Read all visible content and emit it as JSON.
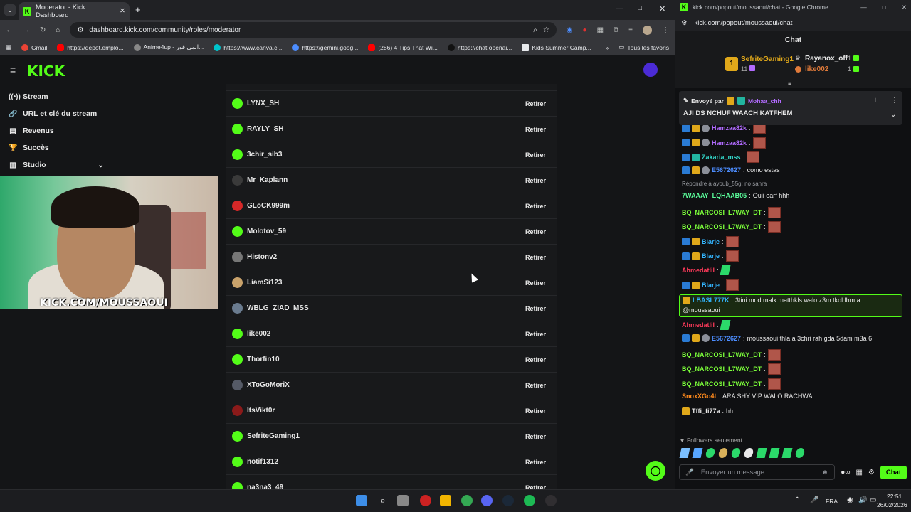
{
  "left_window": {
    "tab_title": "Moderator - Kick Dashboard",
    "url": "dashboard.kick.com/community/roles/moderator",
    "bookmarks": [
      "Gmail",
      "https://depot.emplo...",
      "Anime4up - انمي فور...",
      "https://www.canva.c...",
      "https://gemini.goog...",
      "(286) 4 Tips That Wi...",
      "https://chat.openai...",
      "Kids Summer Camp...",
      "Tous les favoris"
    ]
  },
  "brand": "KICK",
  "sidebar": {
    "items": [
      {
        "icon": "stream-icon",
        "label": "Stream"
      },
      {
        "icon": "link-icon",
        "label": "URL et clé du stream"
      },
      {
        "icon": "revenue-icon",
        "label": "Revenus"
      },
      {
        "icon": "trophy-icon",
        "label": "Succès"
      },
      {
        "icon": "studio-icon",
        "label": "Studio"
      }
    ]
  },
  "webcam_overlay": "KICK.COM/MOUSSAOUI",
  "moderators": {
    "remove_label": "Retirer",
    "rows": [
      {
        "name": "LYNX_SH",
        "avatar_color": "#53fc18"
      },
      {
        "name": "RAYLY_SH",
        "avatar_color": "#53fc18"
      },
      {
        "name": "3chir_sib3",
        "avatar_color": "#53fc18"
      },
      {
        "name": "Mr_Kaplann",
        "avatar_color": "#3a3a3a"
      },
      {
        "name": "GLoCK999m",
        "avatar_color": "#d62828"
      },
      {
        "name": "Molotov_59",
        "avatar_color": "#53fc18"
      },
      {
        "name": "Histonv2",
        "avatar_color": "#777777"
      },
      {
        "name": "LiamSi123",
        "avatar_color": "#c9a26b"
      },
      {
        "name": "WBLG_ZIAD_MSS",
        "avatar_color": "#6a7b8f"
      },
      {
        "name": "like002",
        "avatar_color": "#53fc18"
      },
      {
        "name": "Thorfin10",
        "avatar_color": "#53fc18"
      },
      {
        "name": "XToGoMoriX",
        "avatar_color": "#555a66"
      },
      {
        "name": "ItsVikt0r",
        "avatar_color": "#8b1a1a"
      },
      {
        "name": "SefriteGaming1",
        "avatar_color": "#53fc18"
      },
      {
        "name": "notif1312",
        "avatar_color": "#53fc18"
      },
      {
        "name": "na3na3_49",
        "avatar_color": "#53fc18"
      }
    ]
  },
  "chat": {
    "window_title": "kick.com/popout/moussaoui/chat - Google Chrome",
    "url": "kick.com/popout/moussaoui/chat",
    "header": "Chat",
    "leaders": [
      {
        "rank": "1",
        "name": "SefriteGaming1",
        "count": "11"
      },
      {
        "name": "Rayanox_off",
        "count": "1"
      },
      {
        "name": "like002",
        "count": "1"
      }
    ],
    "pinned": {
      "sent_by": "Envoyé par",
      "author": "Mohaa_chh",
      "message": "AJI DS NCHUF WAACH KATFHEM"
    },
    "messages": [
      {
        "user": "Hamzaa82k",
        "color": "#b26bff",
        "text": "",
        "emote": true
      },
      {
        "user": "Hamzaa82k",
        "color": "#b26bff",
        "text": "",
        "emote": true
      },
      {
        "user": "Zakaria_mss",
        "color": "#33d6c9",
        "text": "",
        "emote": true
      },
      {
        "user": "E5672627",
        "color": "#4c8dff",
        "text": "como estas",
        "emote": false
      },
      {
        "reply": "Répondre à ayoub_55g: no sahra"
      },
      {
        "user": "7WAAAY_LQHAAB05",
        "color": "#5bff9c",
        "text": "Ouii earf hhh",
        "emote": false
      },
      {
        "user": "BQ_NARCOSI_L7WAY_DT",
        "color": "#7cff3a",
        "text": "",
        "emote": true
      },
      {
        "user": "BQ_NARCOSI_L7WAY_DT",
        "color": "#7cff3a",
        "text": "",
        "emote": true
      },
      {
        "user": "Blarje",
        "color": "#33b5ff",
        "text": "",
        "emote": true
      },
      {
        "user": "Blarje",
        "color": "#33b5ff",
        "text": "",
        "emote": true
      },
      {
        "user": "Ahmedatlil",
        "color": "#ff3a5a",
        "text": "",
        "emote": false,
        "gem": true
      },
      {
        "user": "Blarje",
        "color": "#33b5ff",
        "text": "",
        "emote": true
      },
      {
        "user": "LBASL777K",
        "color": "#33b5ff",
        "text": "3tini mod malk matthkls walo z3m tkol lhm a",
        "text2": "@moussaoui",
        "highlight": true
      },
      {
        "user": "Ahmedatlil",
        "color": "#ff3a5a",
        "text": "",
        "emote": false,
        "gem": true
      },
      {
        "user": "E5672627",
        "color": "#4c8dff",
        "text": "moussaoui thla a 3chri rah gda 5dam m3a 6",
        "emote": false
      },
      {
        "user": "BQ_NARCOSI_L7WAY_DT",
        "color": "#7cff3a",
        "text": "",
        "emote": true
      },
      {
        "user": "BQ_NARCOSI_L7WAY_DT",
        "color": "#7cff3a",
        "text": "",
        "emote": true
      },
      {
        "user": "BQ_NARCOSI_L7WAY_DT",
        "color": "#7cff3a",
        "text": "",
        "emote": true
      },
      {
        "user": "SnoxXGo4t",
        "color": "#ff8a1c",
        "text": "ARA SHY VIP WALO RACHWA",
        "emote": false
      },
      {
        "user": "Tffi_fi77a",
        "color": "#e8e8e8",
        "text": "hh",
        "emote": false
      }
    ],
    "followers_only": "Followers seulement",
    "input_placeholder": "Envoyer un message",
    "send_label": "Chat"
  },
  "taskbar": {
    "lang": "FRA",
    "time": "22:51",
    "date": "26/02/2026"
  }
}
